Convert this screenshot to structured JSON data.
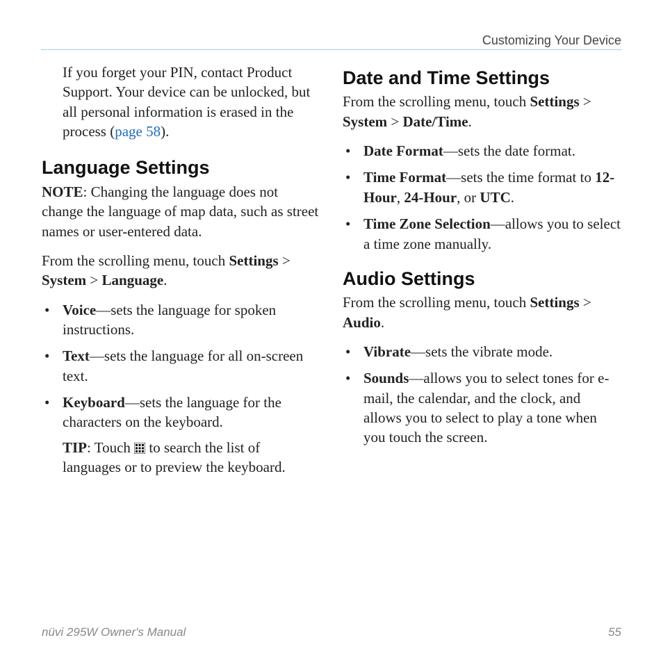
{
  "header": {
    "section_title": "Customizing Your Device"
  },
  "footer": {
    "manual": "nüvi 295W Owner's Manual",
    "page": "55"
  },
  "left": {
    "intro_a": "If you forget your PIN, contact Product Support. Your device can be unlocked, but all personal information is erased in the process (",
    "intro_link": "page 58",
    "intro_b": ").",
    "lang_heading": "Language Settings",
    "note_label": "NOTE",
    "note_text": ": Changing the language does not change the language of map data, such as street names or user-entered data.",
    "path_a": "From the scrolling menu, touch ",
    "path_s1": "Settings",
    "path_s2": "System",
    "path_s3": "Language",
    "items": [
      {
        "term": "Voice",
        "desc": "—sets the language for spoken instructions."
      },
      {
        "term": "Text",
        "desc": "—sets the language for all on-screen text."
      },
      {
        "term": "Keyboard",
        "desc": "—sets the language for the characters on the keyboard."
      }
    ],
    "tip_label": "TIP",
    "tip_a": ": Touch ",
    "tip_b": " to search the list of languages or to preview the keyboard."
  },
  "right": {
    "dt_heading": "Date and Time Settings",
    "dt_path_a": "From the scrolling menu, touch ",
    "dt_s1": "Settings",
    "dt_s2": "System",
    "dt_s3": "Date/Time",
    "dt_items": [
      {
        "term": "Date Format",
        "desc": "—sets the date format."
      },
      {
        "term": "Time Format",
        "desc_a": "—sets the time format to ",
        "b1": "12-Hour",
        "sep1": ", ",
        "b2": "24-Hour",
        "sep2": ", or ",
        "b3": "UTC",
        "tail": "."
      },
      {
        "term": "Time Zone Selection",
        "desc": "—allows you to select a time zone manually."
      }
    ],
    "au_heading": "Audio Settings",
    "au_path_a": "From the scrolling menu, touch ",
    "au_s1": "Settings",
    "au_s2": "Audio",
    "au_items": [
      {
        "term": "Vibrate",
        "desc": "—sets the vibrate mode."
      },
      {
        "term": "Sounds",
        "desc": "—allows you to select tones for e-mail, the calendar, and the clock, and allows you to select to play a tone when you touch the screen."
      }
    ]
  }
}
